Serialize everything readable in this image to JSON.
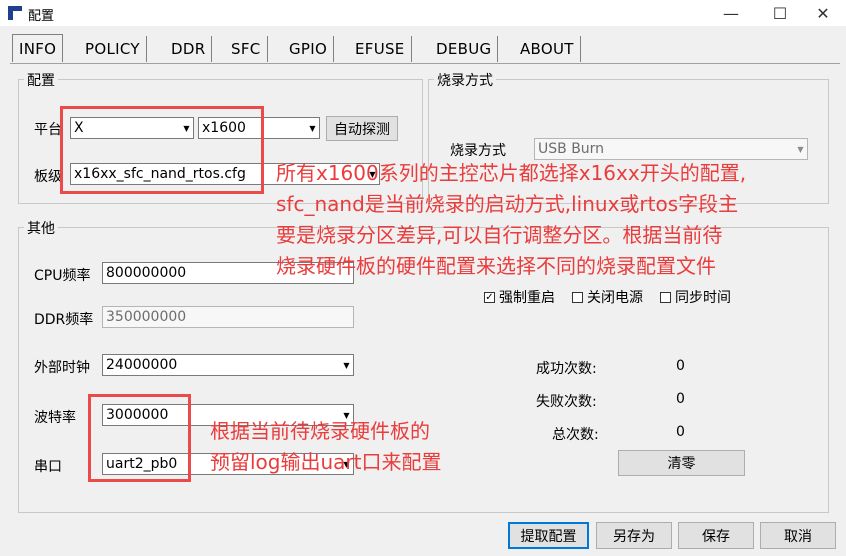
{
  "window": {
    "title": "配置",
    "minimize_glyph": "—",
    "maximize_glyph": "☐",
    "close_glyph": "✕"
  },
  "tabs": [
    {
      "label": "INFO",
      "active": true
    },
    {
      "label": "POLICY",
      "active": false
    },
    {
      "label": "DDR",
      "active": false
    },
    {
      "label": "SFC",
      "active": false
    },
    {
      "label": "GPIO",
      "active": false
    },
    {
      "label": "EFUSE",
      "active": false
    },
    {
      "label": "DEBUG",
      "active": false
    },
    {
      "label": "ABOUT",
      "active": false
    }
  ],
  "config_group": {
    "title": "配置",
    "platform_label": "平台",
    "platform_value": "X",
    "chip_value": "x1600",
    "auto_detect_label": "自动探测",
    "board_label": "板级",
    "board_value": "x16xx_sfc_nand_rtos.cfg"
  },
  "burn_group": {
    "title": "烧录方式",
    "mode_label": "烧录方式",
    "mode_value": "USB Burn"
  },
  "other_group": {
    "title": "其他",
    "cpu_label": "CPU频率",
    "cpu_value": "800000000",
    "ddr_label": "DDR频率",
    "ddr_value": "350000000",
    "ext_clock_label": "外部时钟",
    "ext_clock_value": "24000000",
    "baud_label": "波特率",
    "baud_value": "3000000",
    "serial_label": "串口",
    "serial_value": "uart2_pb0",
    "force_restart_label": "强制重启",
    "force_restart_checked": true,
    "power_off_label": "关闭电源",
    "power_off_checked": false,
    "sync_time_label": "同步时间",
    "sync_time_checked": false,
    "success_label": "成功次数:",
    "success_value": "0",
    "fail_label": "失败次数:",
    "fail_value": "0",
    "total_label": "总次数:",
    "total_value": "0",
    "clear_label": "清零"
  },
  "footer": {
    "fetch_label": "提取配置",
    "save_as_label": "另存为",
    "save_label": "保存",
    "cancel_label": "取消"
  },
  "annotations": {
    "top_lines": [
      "所有x1600系列的主控芯片都选择x16xx开头的配置,",
      "sfc_nand是当前烧录的启动方式,linux或rtos字段主",
      "要是烧录分区差异,可以自行调整分区。根据当前待",
      "烧录硬件板的硬件配置来选择不同的烧录配置文件"
    ],
    "bottom_lines": [
      "根据当前待烧录硬件板的",
      "预留log输出uart口来配置"
    ]
  },
  "colors": {
    "annotation_red": "#ea3c3c",
    "window_bg": "#f0f0f0"
  }
}
